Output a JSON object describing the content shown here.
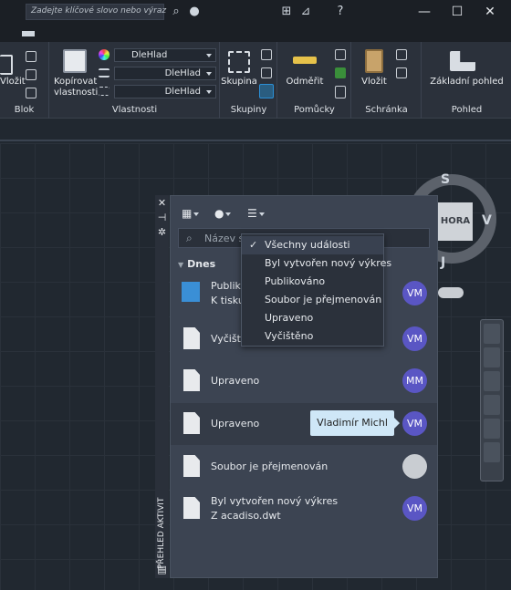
{
  "topbar": {
    "search_placeholder": "Zadejte klíčové slovo nebo výraz",
    "help_icon": "?",
    "window_controls": [
      "—",
      "☐",
      "✕"
    ]
  },
  "ribbon": {
    "panels": [
      {
        "title": "Blok",
        "labels": [
          "Vložit"
        ]
      },
      {
        "title": "Vlastnosti",
        "labels": [
          "Kopírovat",
          "vlastnosti"
        ],
        "dropdowns": [
          "DleHlad",
          "DleHlad",
          "DleHlad"
        ]
      },
      {
        "title": "Skupiny",
        "labels": [
          "Skupina"
        ]
      },
      {
        "title": "Pomůcky",
        "labels": [
          "Odměřit"
        ]
      },
      {
        "title": "Schránka",
        "labels": [
          "Vložit"
        ]
      },
      {
        "title": "Pohled",
        "labels": [
          "Základní pohled"
        ]
      }
    ]
  },
  "viewcube": {
    "face": "HORA",
    "north": "S",
    "east": "V",
    "south": "J"
  },
  "palette": {
    "vertical_title": "PŘEHLED AKTIVIT",
    "search_placeholder": "Název so",
    "section": "Dnes",
    "rows": [
      {
        "line1": "Publiko",
        "line2": "K tisku",
        "avatar": "VM"
      },
      {
        "line1": "Vyčiště",
        "avatar": "VM"
      },
      {
        "line1": "Upraveno",
        "avatar": "MM"
      },
      {
        "line1": "Upraveno",
        "avatar": "VM"
      },
      {
        "line1": "Soubor je přejmenován",
        "avatar": ""
      },
      {
        "line1": "Byl vytvořen nový výkres",
        "line2": "Z acadiso.dwt",
        "avatar": "VM"
      }
    ]
  },
  "filter_menu": {
    "items": [
      {
        "label": "Všechny události",
        "checked": true
      },
      {
        "label": "Byl vytvořen nový výkres"
      },
      {
        "label": "Publikováno"
      },
      {
        "label": "Soubor je přejmenován"
      },
      {
        "label": "Upraveno"
      },
      {
        "label": "Vyčištěno"
      }
    ]
  },
  "tooltip": {
    "text": "Vladimír Michl"
  }
}
